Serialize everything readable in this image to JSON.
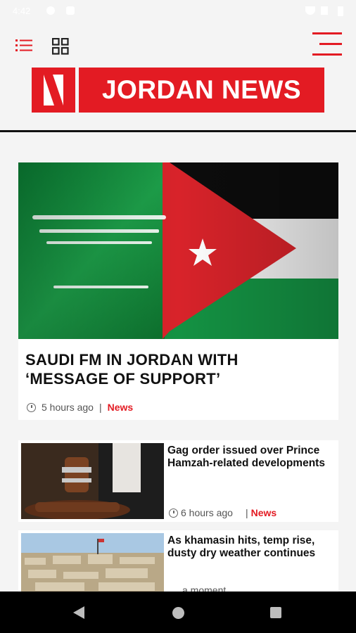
{
  "status_bar": {
    "time": "4:42"
  },
  "brand": {
    "name": "JORDAN NEWS"
  },
  "featured": {
    "title": "SAUDI FM IN JORDAN WITH ‘MESSAGE OF SUPPORT’",
    "time": "5 hours ago",
    "separator": "|",
    "category": "News"
  },
  "articles": [
    {
      "title": "Gag order issued over Prince Hamzah-related developments",
      "time": "6 hours ago",
      "separator": "|",
      "category": "News"
    },
    {
      "title": "As khamasin hits, temp rise, dusty dry weather continues",
      "time": "a moment"
    }
  ],
  "colors": {
    "brand": "#e31b23",
    "background": "#f4f4f4",
    "nav": "#000000"
  },
  "icons": [
    "list-view-icon",
    "grid-view-icon",
    "menu-icon",
    "clock-icon",
    "back-icon",
    "home-icon",
    "recent-apps-icon"
  ]
}
